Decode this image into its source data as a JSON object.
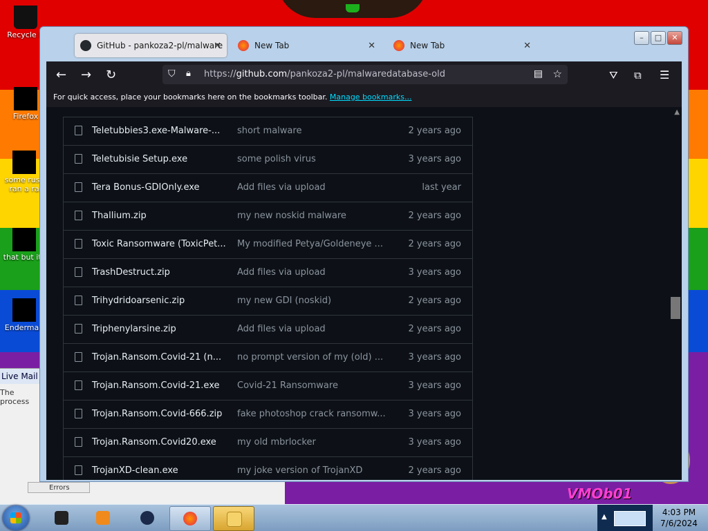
{
  "desktop": {
    "icons": [
      {
        "label": "Recycle B"
      },
      {
        "label": "Firefox"
      },
      {
        "label": "some russ ran a ra"
      },
      {
        "label": "that but its"
      },
      {
        "label": "Enderman"
      }
    ],
    "livemail": {
      "title": "Live Mail",
      "text": "The process",
      "tab": "Errors"
    },
    "wallpaper_text": "VMOb01"
  },
  "browser": {
    "tabs": [
      {
        "label": "GitHub - pankoza2-pl/malware"
      },
      {
        "label": "New Tab"
      },
      {
        "label": "New Tab"
      }
    ],
    "url": {
      "scheme": "https://",
      "host": "github.com",
      "path": "/pankoza2-pl/malwaredatabase-old"
    },
    "bookmarks": {
      "text": "For quick access, place your bookmarks here on the bookmarks toolbar.",
      "link": "Manage bookmarks..."
    },
    "files": [
      {
        "name": "Teletubbies3.exe-Malware-...",
        "message": "short malware",
        "age": "2 years ago"
      },
      {
        "name": "Teletubisie Setup.exe",
        "message": "some polish virus",
        "age": "3 years ago"
      },
      {
        "name": "Tera Bonus-GDIOnly.exe",
        "message": "Add files via upload",
        "age": "last year"
      },
      {
        "name": "Thallium.zip",
        "message": "my new noskid malware",
        "age": "2 years ago"
      },
      {
        "name": "Toxic Ransomware (ToxicPet...",
        "message": "My modified Petya/Goldeneye ...",
        "age": "2 years ago"
      },
      {
        "name": "TrashDestruct.zip",
        "message": "Add files via upload",
        "age": "3 years ago"
      },
      {
        "name": "Trihydridoarsenic.zip",
        "message": "my new GDI (noskid)",
        "age": "2 years ago"
      },
      {
        "name": "Triphenylarsine.zip",
        "message": "Add files via upload",
        "age": "2 years ago"
      },
      {
        "name": "Trojan.Ransom.Covid-21 (n...",
        "message": "no prompt version of my (old) ...",
        "age": "3 years ago"
      },
      {
        "name": "Trojan.Ransom.Covid-21.exe",
        "message": "Covid-21 Ransomware",
        "age": "3 years ago"
      },
      {
        "name": "Trojan.Ransom.Covid-666.zip",
        "message": "fake photoshop crack ransomw...",
        "age": "3 years ago"
      },
      {
        "name": "Trojan.Ransom.Covid20.exe",
        "message": "my old mbrlocker",
        "age": "3 years ago"
      },
      {
        "name": "TrojanXD-clean.exe",
        "message": "my joke version of TrojanXD",
        "age": "2 years ago"
      }
    ]
  },
  "taskbar": {
    "clock_time": "4:03 PM",
    "clock_date": "7/6/2024"
  },
  "colors": {
    "page_bg": "#0d1117",
    "row_border": "#30363d",
    "link": "#00ddff"
  }
}
